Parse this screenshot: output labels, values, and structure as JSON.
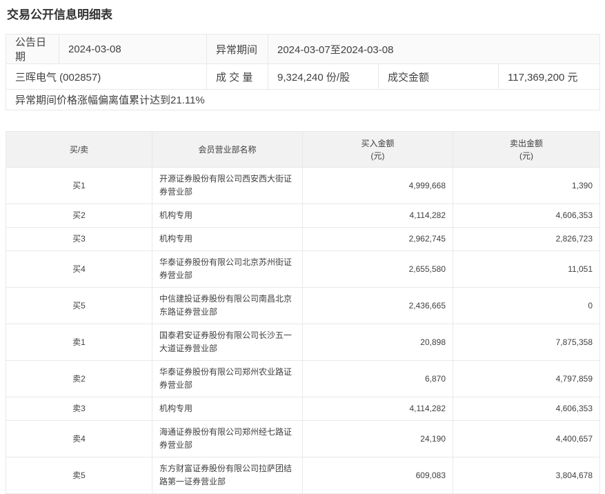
{
  "title": "交易公开信息明细表",
  "summary": {
    "announce_date_label": "公告日期",
    "announce_date": "2024-03-08",
    "abnormal_period_label": "异常期间",
    "abnormal_period": "2024-03-07至2024-03-08",
    "stock": "三晖电气 (002857)",
    "volume_label": "成 交 量",
    "volume": "9,324,240 份/股",
    "amount_label": "成交金额",
    "amount": "117,369,200 元",
    "deviation_note": "异常期间价格涨幅偏离值累计达到21.11%"
  },
  "table": {
    "headers": [
      {
        "line1": "买/卖"
      },
      {
        "line1": "会员营业部名称"
      },
      {
        "line1": "买入金额",
        "line2": "(元)"
      },
      {
        "line1": "卖出金额",
        "line2": "(元)"
      }
    ],
    "rows": [
      {
        "rank": "买1",
        "name": "开源证券股份有限公司西安西大街证券营业部",
        "buy": "4,999,668",
        "sell": "1,390"
      },
      {
        "rank": "买2",
        "name": "机构专用",
        "buy": "4,114,282",
        "sell": "4,606,353"
      },
      {
        "rank": "买3",
        "name": "机构专用",
        "buy": "2,962,745",
        "sell": "2,826,723"
      },
      {
        "rank": "买4",
        "name": "华泰证券股份有限公司北京苏州街证券营业部",
        "buy": "2,655,580",
        "sell": "11,051"
      },
      {
        "rank": "买5",
        "name": "中信建投证券股份有限公司南昌北京东路证券营业部",
        "buy": "2,436,665",
        "sell": "0"
      },
      {
        "rank": "卖1",
        "name": "国泰君安证券股份有限公司长沙五一大道证券营业部",
        "buy": "20,898",
        "sell": "7,875,358"
      },
      {
        "rank": "卖2",
        "name": "华泰证券股份有限公司郑州农业路证券营业部",
        "buy": "6,870",
        "sell": "4,797,859"
      },
      {
        "rank": "卖3",
        "name": "机构专用",
        "buy": "4,114,282",
        "sell": "4,606,353"
      },
      {
        "rank": "卖4",
        "name": "海通证券股份有限公司郑州经七路证券营业部",
        "buy": "24,190",
        "sell": "4,400,657"
      },
      {
        "rank": "卖5",
        "name": "东方财富证券股份有限公司拉萨团结路第一证券营业部",
        "buy": "609,083",
        "sell": "3,804,678"
      }
    ]
  },
  "colors": {
    "header_bg": "#f2f2f2",
    "summary_row1_bg": "#fafafa",
    "border": "#e8e8e8",
    "text": "#404040",
    "title_text": "#333333"
  }
}
